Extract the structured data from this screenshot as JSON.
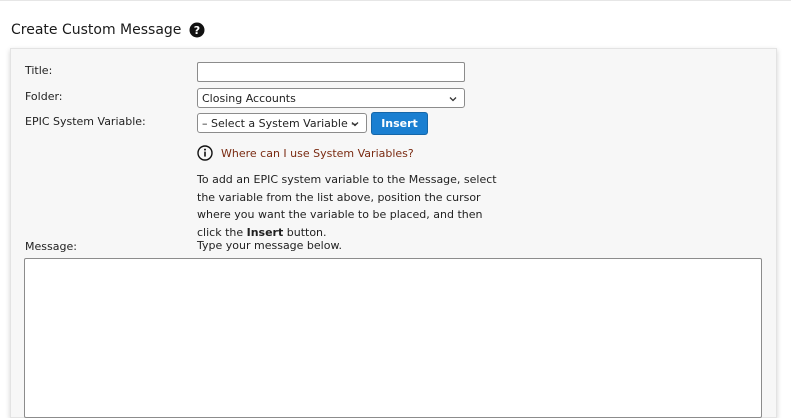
{
  "header": {
    "title": "Create Custom Message"
  },
  "form": {
    "title_label": "Title:",
    "title_value": "",
    "folder_label": "Folder:",
    "folder_value": "Closing Accounts",
    "variable_label": "EPIC System Variable:",
    "variable_value": "– Select a System Variable –",
    "insert_label": "Insert",
    "info_link": "Where can I use System Variables?",
    "instructions_prefix": "To add an EPIC system variable to the Message, select the variable from the list above, position the cursor where you want the variable to be placed, and then click the ",
    "instructions_bold": "Insert",
    "instructions_suffix": " button.",
    "message_label": "Message:",
    "message_hint": "Type your message below.",
    "message_value": ""
  },
  "colors": {
    "accent": "#1a7fd1",
    "link": "#7a2b12",
    "panel_bg": "#f7f7f7"
  },
  "icons": {
    "help": "question-circle-icon",
    "info": "info-circle-icon",
    "select_chevron": "chevron-down-icon"
  }
}
